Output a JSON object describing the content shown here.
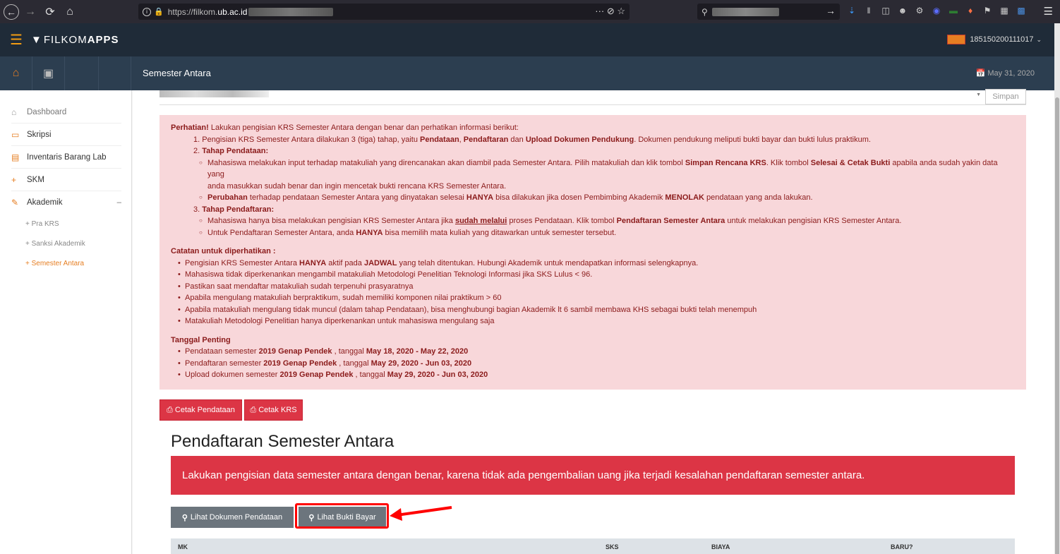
{
  "browser": {
    "url_prefix": "https://filkom.",
    "url_domain": "ub.ac.id",
    "url_actions": "··· ⊘ ☆",
    "search_go": "→"
  },
  "app": {
    "brand_a": "FILKOM",
    "brand_b": "APPS",
    "user_id": "185150200111017",
    "page_heading": "Semester Antara",
    "date": "May 31, 2020"
  },
  "sidebar": {
    "items": [
      {
        "label": "Dashboard"
      },
      {
        "label": "Skripsi"
      },
      {
        "label": "Inventaris Barang Lab"
      },
      {
        "label": "SKM"
      },
      {
        "label": "Akademik"
      }
    ],
    "sub_items": [
      {
        "label": "Pra KRS"
      },
      {
        "label": "Sanksi Akademik"
      },
      {
        "label": "Semester Antara"
      }
    ]
  },
  "form": {
    "save_label": "Simpan"
  },
  "alert": {
    "attention": "Perhatian!",
    "attention_text": " Lakukan pengisian KRS Semester Antara dengan benar dan perhatikan informasi berikut:",
    "s1_a": "Pengisian KRS Semester Antara dilakukan 3 (tiga) tahap, yaitu ",
    "s1_b": "Pendataan",
    "s1_c": ", ",
    "s1_d": "Pendaftaran",
    "s1_e": " dan ",
    "s1_f": "Upload Dokumen Pendukung",
    "s1_g": ". Dokumen pendukung meliputi bukti bayar dan bukti lulus praktikum.",
    "s2_title": "Tahap Pendataan:",
    "s2_a1": "Mahasiswa melakukan input terhadap matakuliah yang direncanakan akan diambil pada Semester Antara. Pilih matakuliah dan klik tombol ",
    "s2_a2": "Simpan Rencana KRS",
    "s2_a3": ". Klik tombol ",
    "s2_a4": "Selesai & Cetak Bukti",
    "s2_a5": " apabila anda sudah yakin data yang",
    "s2_a6": "anda masukkan sudah benar dan ingin mencetak bukti rencana KRS Semester Antara.",
    "s2_b1": "Perubahan",
    "s2_b2": " terhadap pendataan Semester Antara yang dinyatakan selesai ",
    "s2_b3": "HANYA",
    "s2_b4": " bisa dilakukan jika dosen Pembimbing Akademik ",
    "s2_b5": "MENOLAK",
    "s2_b6": " pendataan yang anda lakukan.",
    "s3_title": "Tahap Pendaftaran:",
    "s3_a1": "Mahasiswa hanya bisa melakukan pengisian KRS Semester Antara jika ",
    "s3_a2": "sudah melalui",
    "s3_a3": " proses Pendataan. Klik tombol ",
    "s3_a4": "Pendaftaran Semester Antara",
    "s3_a5": " untuk melakukan pengisian KRS Semester Antara.",
    "s3_b1": "Untuk Pendaftaran Semester Antara, anda ",
    "s3_b2": "HANYA",
    "s3_b3": " bisa memilih mata kuliah yang ditawarkan untuk semester tersebut.",
    "notes_title": "Catatan untuk diperhatikan :",
    "n1_a": "Pengisian KRS Semester Antara ",
    "n1_b": "HANYA",
    "n1_c": " aktif pada ",
    "n1_d": "JADWAL",
    "n1_e": " yang telah ditentukan. Hubungi Akademik untuk mendapatkan informasi selengkapnya.",
    "n2": "Mahasiswa tidak diperkenankan mengambil matakuliah Metodologi Penelitian Teknologi Informasi jika SKS Lulus < 96.",
    "n3": "Pastikan saat mendaftar matakuliah sudah terpenuhi prasyaratnya",
    "n4": "Apabila mengulang matakuliah berpraktikum, sudah memiliki komponen nilai praktikum > 60",
    "n5": "Apabila matakuliah mengulang tidak muncul (dalam tahap Pendataan), bisa menghubungi bagian Akademik lt 6 sambil membawa KHS sebagai bukti telah menempuh",
    "n6": "Matakuliah Metodologi Penelitian hanya diperkenankan untuk mahasiswa mengulang saja",
    "dates_title": "Tanggal Penting",
    "d1_a": "Pendataan semester ",
    "d1_b": "2019 Genap Pendek",
    "d1_c": " , tanggal ",
    "d1_d": "May 18, 2020 - May 22, 2020",
    "d2_a": "Pendaftaran semester ",
    "d2_b": "2019 Genap Pendek",
    "d2_c": " , tanggal ",
    "d2_d": "May 29, 2020 - Jun 03, 2020",
    "d3_a": "Upload dokumen semester ",
    "d3_b": "2019 Genap Pendek",
    "d3_c": " , tanggal ",
    "d3_d": "May 29, 2020 - Jun 03, 2020"
  },
  "actions": {
    "cetak_pendataan": "Cetak Pendataan",
    "cetak_krs": "Cetak KRS"
  },
  "registration": {
    "title": "Pendaftaran Semester Antara",
    "warning": "Lakukan pengisian data semester antara dengan benar, karena tidak ada pengembalian uang jika terjadi kesalahan pendaftaran semester antara.",
    "btn_dokumen": "Lihat Dokumen Pendataan",
    "btn_bukti": "Lihat Bukti Bayar",
    "columns": [
      "MK",
      "SKS",
      "BIAYA",
      "BARU?"
    ]
  },
  "colors": {
    "accent": "#e67e22",
    "danger": "#dc3545",
    "highlight": "#ff0000"
  }
}
